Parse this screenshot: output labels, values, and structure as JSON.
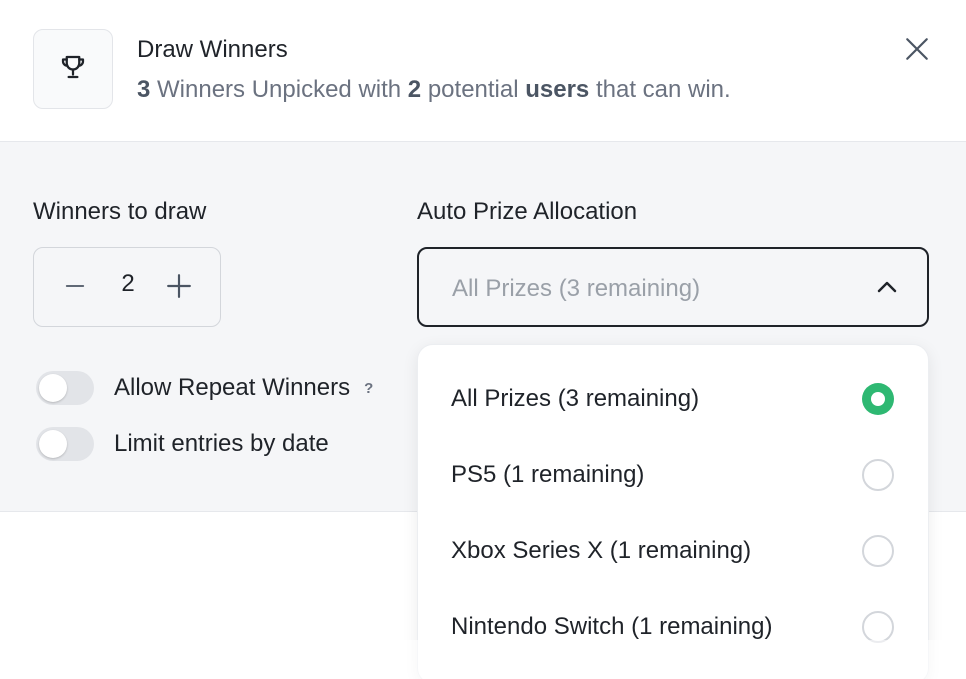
{
  "header": {
    "title": "Draw Winners",
    "subtitle": {
      "count_unpicked": "3",
      "text_1": " Winners Unpicked with ",
      "count_users": "2",
      "text_2": " potential ",
      "users_word": "users",
      "text_3": " that can win."
    },
    "icons": {
      "trophy": "trophy-icon",
      "close": "close-icon"
    }
  },
  "winners": {
    "label": "Winners to draw",
    "value": "2",
    "icons": {
      "decrement": "minus-icon",
      "increment": "plus-icon"
    }
  },
  "allocation": {
    "label": "Auto Prize Allocation",
    "selected": "All Prizes (3 remaining)",
    "icon": "chevron-up-icon",
    "options": [
      {
        "label": "All Prizes (3 remaining)",
        "selected": true
      },
      {
        "label": "PS5 (1 remaining)",
        "selected": false
      },
      {
        "label": "Xbox Series X (1 remaining)",
        "selected": false
      },
      {
        "label": "Nintendo Switch (1 remaining)",
        "selected": false
      }
    ]
  },
  "toggles": {
    "repeat": {
      "label": "Allow Repeat Winners",
      "on": false,
      "help": "?"
    },
    "limit": {
      "label": "Limit entries by date",
      "on": false
    }
  },
  "colors": {
    "accent_green": "#2eb872",
    "panel_bg": "#f5f6f8",
    "text_dark": "#1f2329",
    "text_muted": "#6b7280"
  }
}
